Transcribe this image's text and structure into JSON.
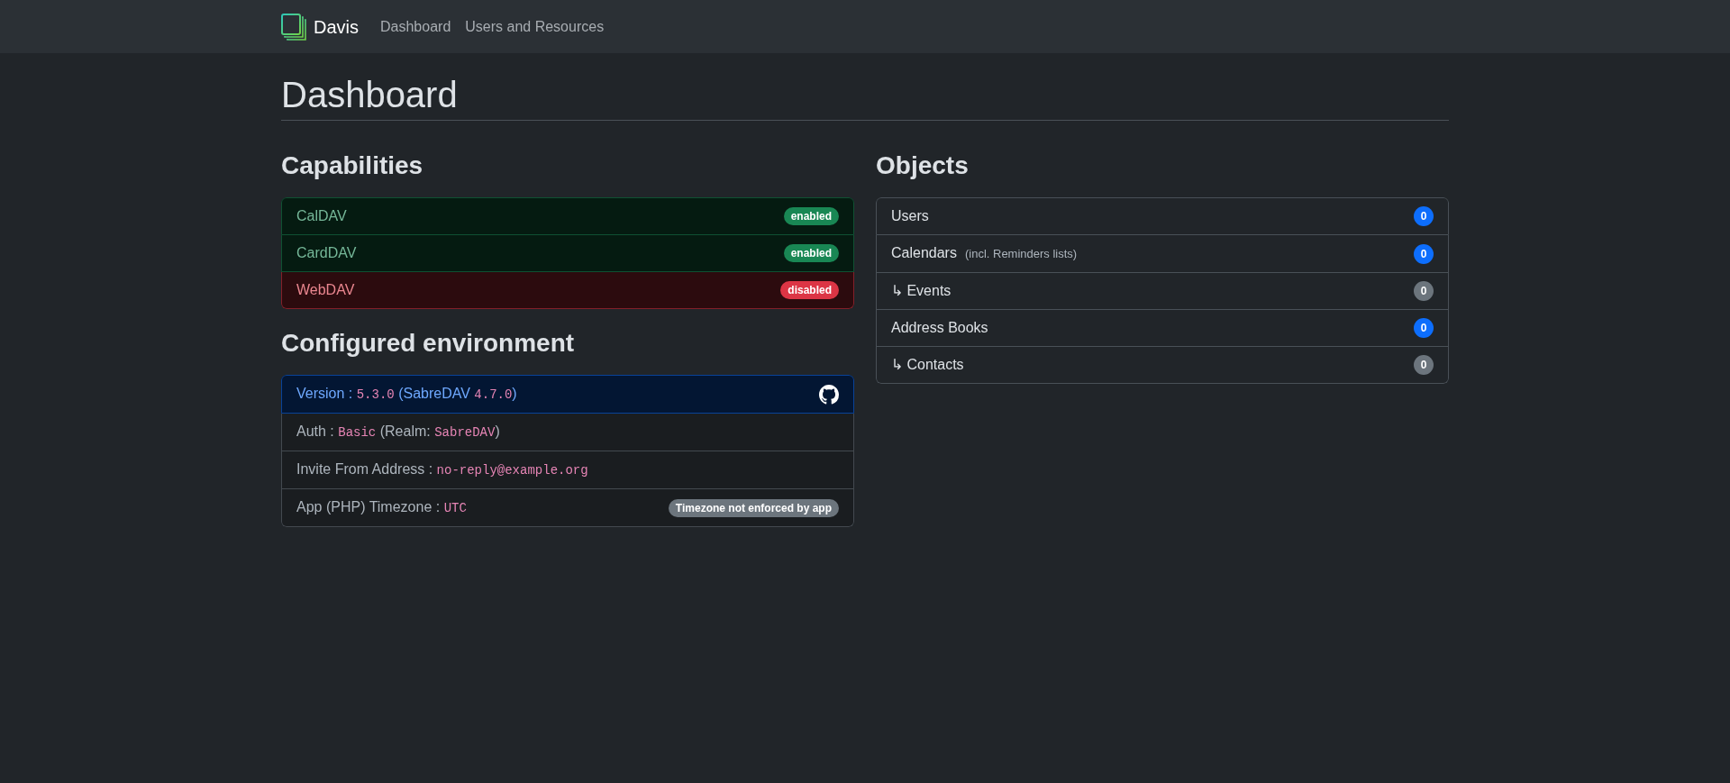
{
  "navbar": {
    "brand": "Davis",
    "links": [
      "Dashboard",
      "Users and Resources"
    ]
  },
  "page_title": "Dashboard",
  "capabilities": {
    "title": "Capabilities",
    "items": [
      {
        "label": "CalDAV",
        "enabled": true,
        "status": "enabled"
      },
      {
        "label": "CardDAV",
        "enabled": true,
        "status": "enabled"
      },
      {
        "label": "WebDAV",
        "enabled": false,
        "status": "disabled"
      }
    ]
  },
  "environment": {
    "title": "Configured environment",
    "rows": [
      {
        "kind": "version",
        "segments": [
          {
            "kind": "text",
            "text": "Version : "
          },
          {
            "kind": "code",
            "text": "5.3.0"
          },
          {
            "kind": "text",
            "text": " (SabreDAV "
          },
          {
            "kind": "code",
            "text": "4.7.0"
          },
          {
            "kind": "text",
            "text": ")"
          }
        ]
      },
      {
        "kind": "setting",
        "segments": [
          {
            "kind": "text",
            "text": "Auth : "
          },
          {
            "kind": "code",
            "text": "Basic"
          },
          {
            "kind": "text",
            "text": " (Realm: "
          },
          {
            "kind": "code",
            "text": "SabreDAV"
          },
          {
            "kind": "text",
            "text": ")"
          }
        ]
      },
      {
        "kind": "setting",
        "segments": [
          {
            "kind": "text",
            "text": "Invite From Address : "
          },
          {
            "kind": "code",
            "text": "no-reply@example.org"
          }
        ]
      },
      {
        "kind": "setting",
        "segments": [
          {
            "kind": "text",
            "text": "App (PHP) Timezone : "
          },
          {
            "kind": "code",
            "text": "UTC"
          }
        ],
        "note": "Timezone not enforced by app"
      }
    ]
  },
  "objects": {
    "title": "Objects",
    "items": [
      {
        "label": "Users",
        "count": "0",
        "color": "#0d6efd"
      },
      {
        "label": "Calendars",
        "note": "(incl. Reminders lists)",
        "count": "0",
        "color": "#0d6efd"
      },
      {
        "label": "↳ Events",
        "count": "0",
        "color": "#6c757d"
      },
      {
        "label": "Address Books",
        "count": "0",
        "color": "#0d6efd"
      },
      {
        "label": "↳ Contacts",
        "count": "0",
        "color": "#6c757d"
      }
    ]
  }
}
